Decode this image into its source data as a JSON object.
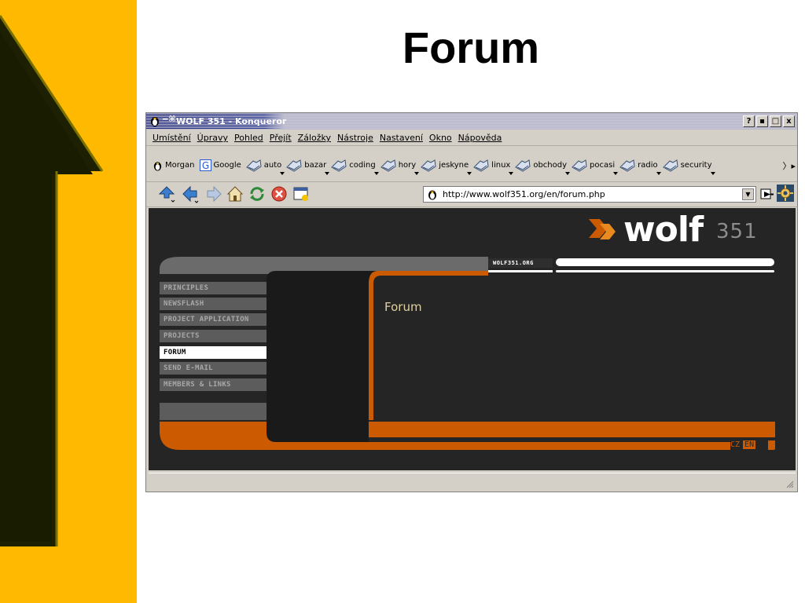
{
  "slide": {
    "title": "Forum"
  },
  "window": {
    "title": "WOLF 351 - Konqueror",
    "controls": [
      "?",
      "▪",
      "□",
      "x"
    ]
  },
  "menu": [
    "Umístění",
    "Úpravy",
    "Pohled",
    "Přejít",
    "Záložky",
    "Nástroje",
    "Nastavení",
    "Okno",
    "Nápověda"
  ],
  "bookmarks": [
    {
      "label": "Morgan",
      "icon": "tux-icon",
      "dropdown": false
    },
    {
      "label": "Google",
      "icon": "google-icon",
      "dropdown": false
    },
    {
      "label": "auto",
      "icon": "folder-icon",
      "dropdown": true
    },
    {
      "label": "bazar",
      "icon": "folder-icon",
      "dropdown": true
    },
    {
      "label": "coding",
      "icon": "folder-icon",
      "dropdown": true
    },
    {
      "label": "hory",
      "icon": "folder-icon",
      "dropdown": true
    },
    {
      "label": "jeskyne",
      "icon": "folder-icon",
      "dropdown": true
    },
    {
      "label": "linux",
      "icon": "folder-icon",
      "dropdown": true
    },
    {
      "label": "obchody",
      "icon": "folder-icon",
      "dropdown": true
    },
    {
      "label": "pocasi",
      "icon": "folder-icon",
      "dropdown": true
    },
    {
      "label": "radio",
      "icon": "folder-icon",
      "dropdown": true
    },
    {
      "label": "security",
      "icon": "folder-icon",
      "dropdown": true
    }
  ],
  "toolbar": {
    "url": "http://www.wolf351.org/en/forum.php",
    "buttons": [
      "up-icon",
      "back-icon",
      "forward-icon",
      "home-icon",
      "reload-icon",
      "stop-icon",
      "new-window-icon"
    ]
  },
  "site": {
    "logo": "wolf",
    "logo_number": "351",
    "domain_tab": "WOLF351.ORG",
    "nav": [
      {
        "label": "PRINCIPLES",
        "active": false
      },
      {
        "label": "NEWSFLASH",
        "active": false
      },
      {
        "label": "PROJECT APPLICATION",
        "active": false
      },
      {
        "label": "PROJECTS",
        "active": false
      },
      {
        "label": "FORUM",
        "active": true
      },
      {
        "label": "SEND E-MAIL",
        "active": false
      },
      {
        "label": "MEMBERS & LINKS",
        "active": false
      }
    ],
    "heading": "Forum",
    "lang_cz": "CZ",
    "lang_en": "EN"
  },
  "colors": {
    "slide_yellow": "#ffb900",
    "arrow_dark": "#1e2004",
    "site_bg": "#252525",
    "site_orange": "#cc5a00",
    "site_grey": "#6b6b6b"
  }
}
